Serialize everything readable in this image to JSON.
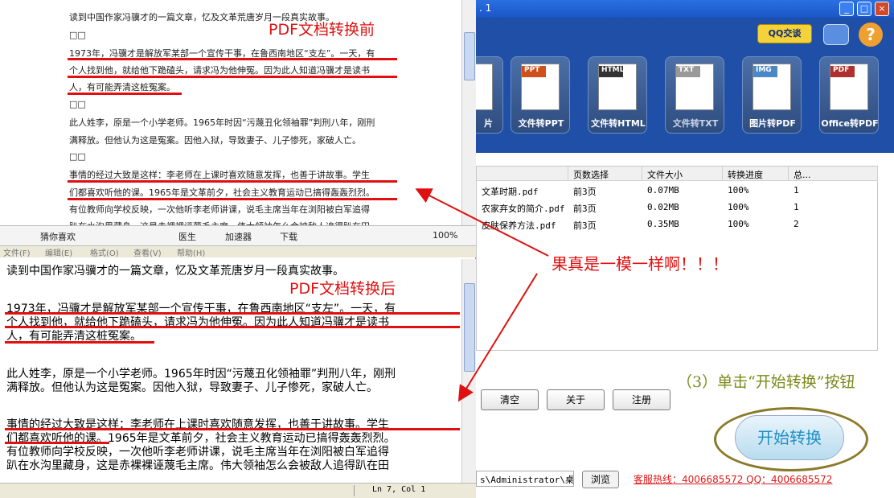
{
  "app": {
    "title_fragment": ". 1",
    "window_buttons": [
      "_",
      "□",
      "×"
    ],
    "qq_badge": "QQ交谈",
    "help": "?",
    "tools": [
      {
        "tag": "",
        "label": "片"
      },
      {
        "tag": "PPT",
        "label": "文件转PPT"
      },
      {
        "tag": "HTML",
        "label": "文件转HTML"
      },
      {
        "tag": "TXT",
        "label": "文件转TXT"
      },
      {
        "tag": "IMG",
        "label": "图片转PDF"
      },
      {
        "tag": "PDF",
        "label": "Office转PDF"
      }
    ],
    "table": {
      "headers": [
        "",
        "页数选择",
        "文件大小",
        "转换进度",
        "总..."
      ],
      "rows": [
        [
          "文革时期.pdf",
          "前3页",
          "0.07MB",
          "100%",
          "1"
        ],
        [
          "农家弃女的简介.pdf",
          "前3页",
          "0.02MB",
          "100%",
          "1"
        ],
        [
          "皮肤保养方法.pdf",
          "前3页",
          "0.35MB",
          "100%",
          "2"
        ]
      ]
    },
    "buttons": {
      "clear": "清空",
      "about": "关于",
      "register": "注册"
    },
    "step3": "（3）单击“开始转换”按钮",
    "start": "开始转换",
    "path": "s\\Administrator\\桌面",
    "browse": "浏览",
    "hotline": "客服热线：4006685572 QQ：4006685572"
  },
  "before": {
    "label": "PDF文档转换前",
    "lines": [
      "读到中国作家冯骥才的一篇文章，忆及文革荒唐岁月一段真实故事。",
      "□□",
      "1973年，冯骥才是解放军某部一个宣传干事，在鲁西南地区“支左”。一天，有",
      "个人找到他，就给他下跪磕头，请求冯为他伸冤。因为此人知道冯骥才是读书",
      "人，有可能弄清这桩冤案。",
      "□□",
      "此人姓李，原是一个小学老师。1965年时因“污蔑丑化领袖罪”判刑八年，刚刑",
      "满释放。但他认为这是冤案。因他入狱，导致妻子、儿子惨死，家破人亡。",
      "□□",
      "事情的经过大致是这样：李老师在上课时喜欢随意发挥，也善于讲故事。学生",
      "们都喜欢听他的课。1965年是文革前夕，社会主义教育运动已搞得轰轰烈烈。",
      "有位教师向学校反映，一次他听李老师讲课，说毛主席当年在浏阳被白军追得",
      "趴在水沟里藏身，这是赤裸裸诬蔑毛主席。伟大领袖怎么会被敌人追得趴在田"
    ]
  },
  "browser_toolbar": {
    "items": [
      "猜你喜欢",
      "医生",
      "加速器",
      "下载",
      "100%"
    ]
  },
  "after": {
    "label": "PDF文档转换后",
    "menu": [
      "文件(F)",
      "编辑(E)",
      "格式(O)",
      "查看(V)",
      "帮助(H)"
    ],
    "lines": [
      "读到中国作家冯骥才的一篇文章，忆及文革荒唐岁月一段真实故事。",
      "1973年，冯骥才是解放军某部一个宣传干事，在鲁西南地区“支左”。一天，有",
      "个人找到他，就给他下跪磕头，请求冯为他伸冤。因为此人知道冯骥才是读书",
      "人，有可能弄清这桩冤案。",
      "此人姓李，原是一个小学老师。1965年时因“污蔑丑化领袖罪”判刑八年，刚刑",
      "满释放。但他认为这是冤案。因他入狱，导致妻子、儿子惨死，家破人亡。",
      "事情的经过大致是这样：李老师在上课时喜欢随意发挥，也善于讲故事。学生",
      "们都喜欢听他的课。1965年是文革前夕，社会主义教育运动已搞得轰轰烈烈。",
      "有位教师向学校反映，一次他听李老师讲课，说毛主席当年在浏阳被白军追得",
      "趴在水沟里藏身，这是赤裸裸诬蔑毛主席。伟大领袖怎么会被敌人追得趴在田"
    ],
    "status": "Ln 7, Col 1"
  },
  "annotation": "果真是一模一样啊！！！",
  "colors": {
    "red": "#e01010",
    "header_blue": "#1f4fa6",
    "accent": "#1d8fc7"
  }
}
